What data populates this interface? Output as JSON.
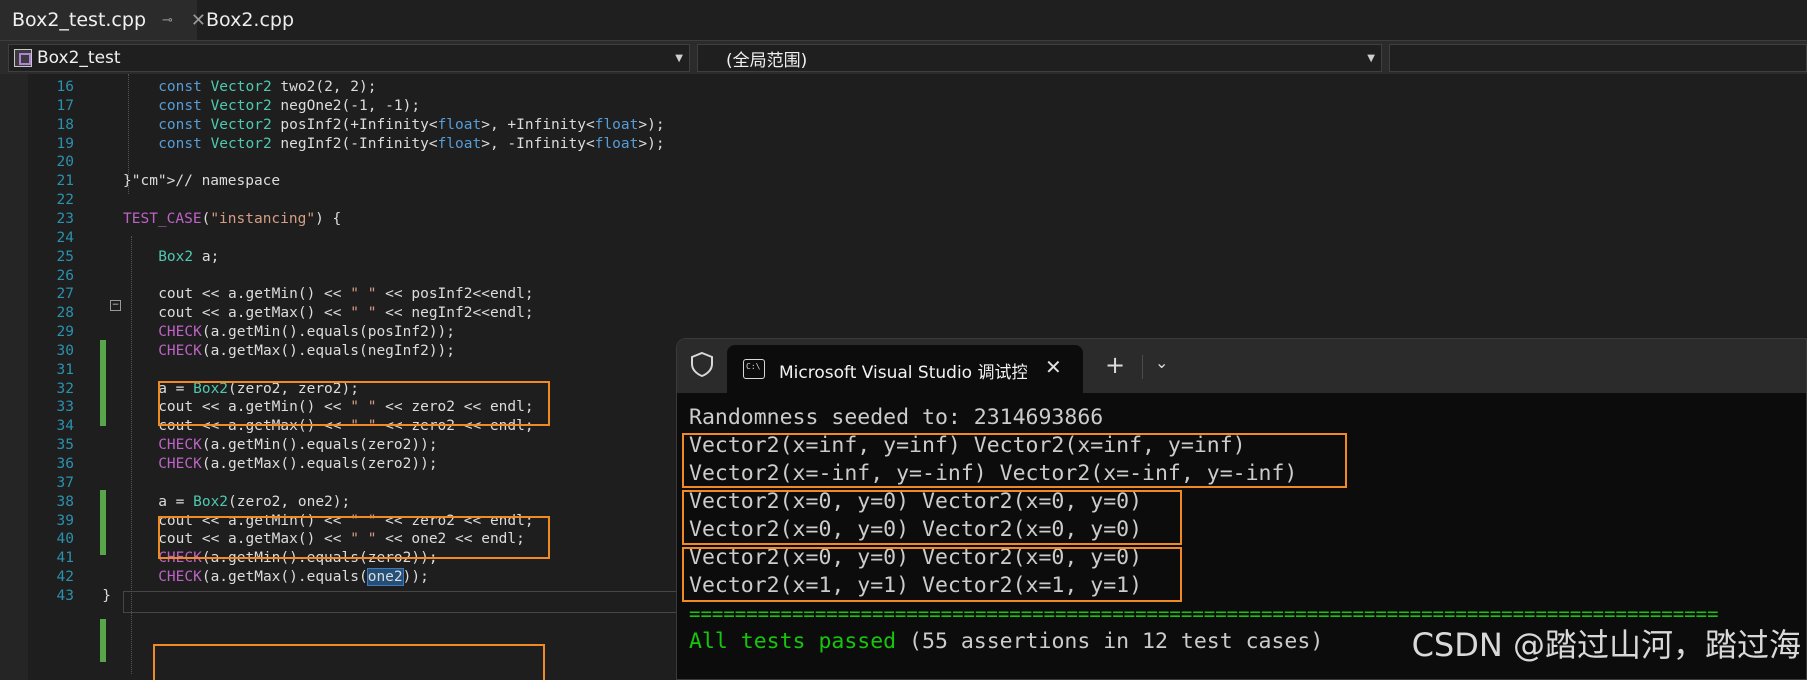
{
  "tabs": [
    {
      "label": "Box2_test.cpp",
      "active": true
    },
    {
      "label": "Box2.cpp",
      "active": false
    }
  ],
  "navbar": {
    "project": "Box2_test",
    "scope": "(全局范围)",
    "member": ""
  },
  "editor": {
    "line_numbers": [
      "16",
      "17",
      "18",
      "19",
      "20",
      "21",
      "22",
      "23",
      "24",
      "25",
      "26",
      "27",
      "28",
      "29",
      "30",
      "31",
      "32",
      "33",
      "34",
      "35",
      "36",
      "37",
      "38",
      "39",
      "40",
      "41",
      "42",
      "43"
    ],
    "lines": [
      "const Vector2 two2(2, 2);",
      "const Vector2 negOne2(-1, -1);",
      "const Vector2 posInf2(+Infinity<float>, +Infinity<float>);",
      "const Vector2 negInf2(-Infinity<float>, -Infinity<float>);",
      "",
      "}// namespace",
      "",
      "TEST_CASE(\"instancing\") {",
      "",
      "Box2 a;",
      "",
      "cout << a.getMin() << \" \" << posInf2<<endl;",
      "cout << a.getMax() << \" \" << negInf2<<endl;",
      "CHECK(a.getMin().equals(posInf2));",
      "CHECK(a.getMax().equals(negInf2));",
      "",
      "a = Box2(zero2, zero2);",
      "cout << a.getMin() << \" \" << zero2 << endl;",
      "cout << a.getMax() << \" \" << zero2 << endl;",
      "CHECK(a.getMin().equals(zero2));",
      "CHECK(a.getMax().equals(zero2));",
      "",
      "a = Box2(zero2, one2);",
      "cout << a.getMin() << \" \" << zero2 << endl;",
      "cout << a.getMax() << \" \" << one2 << endl;",
      "CHECK(a.getMin().equals(zero2));",
      "CHECK(a.getMax().equals(one2));",
      "}"
    ]
  },
  "console": {
    "title": "Microsoft Visual Studio 调试控制台",
    "new_tab": "+",
    "output": [
      "Randomness seeded to: 2314693866",
      "Vector2(x=inf, y=inf) Vector2(x=inf, y=inf)",
      "Vector2(x=-inf, y=-inf) Vector2(x=-inf, y=-inf)",
      "Vector2(x=0, y=0) Vector2(x=0, y=0)",
      "Vector2(x=0, y=0) Vector2(x=0, y=0)",
      "Vector2(x=0, y=0) Vector2(x=0, y=0)",
      "Vector2(x=1, y=1) Vector2(x=1, y=1)",
      "==========================================================================================",
      "All tests passed",
      " (55 assertions in 12 test cases)"
    ]
  },
  "watermark": "CSDN @踏过山河，踏过海",
  "colors": {
    "accent_box": "#f08a24",
    "pass_green": "#16c60c",
    "keyword": "#569cd6",
    "type": "#4ec9b0"
  }
}
